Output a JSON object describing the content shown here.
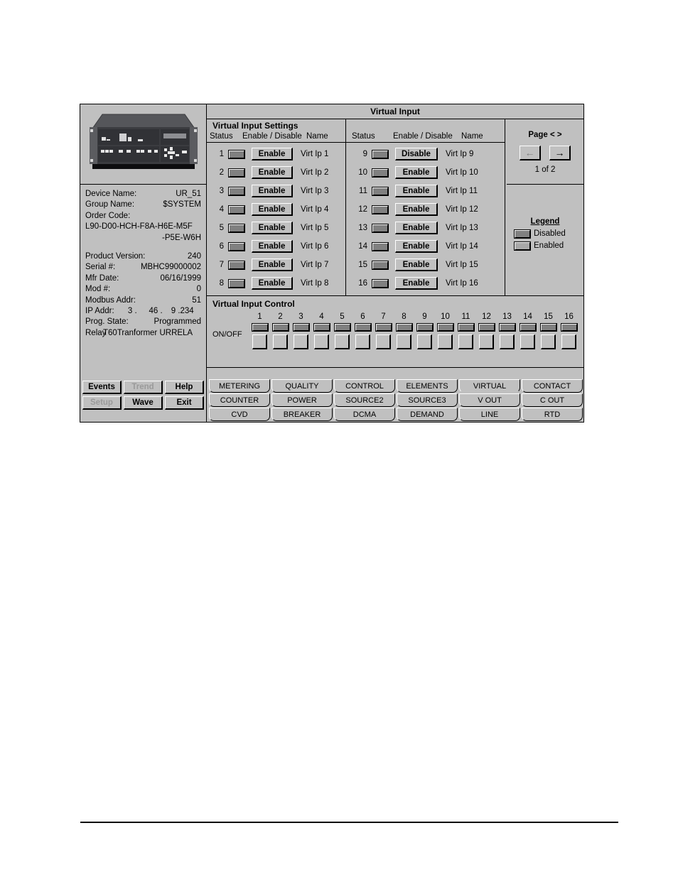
{
  "window": {
    "title": "Virtual Input"
  },
  "device": {
    "picture_alt": "relay-front-panel",
    "fields": [
      {
        "key": "Device Name:",
        "value": "UR_51"
      },
      {
        "key": "Group Name:",
        "value": "$SYSTEM"
      }
    ],
    "order_code_label": "Order Code:",
    "order_code_line1": "L90-D00-HCH-F8A-H6E-M5F",
    "order_code_line2": "-P5E-W6H",
    "fields2": [
      {
        "key": "Product Version:",
        "value": "240"
      },
      {
        "key": "Serial #:",
        "value": "MBHC99000002"
      },
      {
        "key": "Mfr Date:",
        "value": "06/16/1999"
      },
      {
        "key": "Mod #:",
        "value": "0"
      },
      {
        "key": "Modbus Addr:",
        "value": "51"
      }
    ],
    "ip_label": "IP Addr:",
    "ip_octets": [
      "3 .",
      "46 .",
      "9 .234"
    ],
    "prog_state_key": "Prog. State:",
    "prog_state_value": "Programmed",
    "footer_a": "Relay",
    "footer_b": "T60Tranformer URRELA"
  },
  "settings": {
    "panel_title": "Virtual Input Settings",
    "headers": {
      "status": "Status",
      "enable_disable": "Enable / Disable",
      "name": "Name"
    },
    "column1": [
      {
        "index": "1",
        "state": "disabled",
        "button": "Enable",
        "name": "Virt Ip 1"
      },
      {
        "index": "2",
        "state": "disabled",
        "button": "Enable",
        "name": "Virt Ip 2"
      },
      {
        "index": "3",
        "state": "disabled",
        "button": "Enable",
        "name": "Virt Ip 3"
      },
      {
        "index": "4",
        "state": "disabled",
        "button": "Enable",
        "name": "Virt Ip 4"
      },
      {
        "index": "5",
        "state": "disabled",
        "button": "Enable",
        "name": "Virt Ip 5"
      },
      {
        "index": "6",
        "state": "disabled",
        "button": "Enable",
        "name": "Virt Ip 6"
      },
      {
        "index": "7",
        "state": "disabled",
        "button": "Enable",
        "name": "Virt Ip 7"
      },
      {
        "index": "8",
        "state": "disabled",
        "button": "Enable",
        "name": "Virt Ip 8"
      }
    ],
    "column2": [
      {
        "index": "9",
        "state": "disabled",
        "button": "Disable",
        "name": "Virt Ip 9"
      },
      {
        "index": "10",
        "state": "disabled",
        "button": "Enable",
        "name": "Virt Ip 10"
      },
      {
        "index": "11",
        "state": "disabled",
        "button": "Enable",
        "name": "Virt Ip 11"
      },
      {
        "index": "12",
        "state": "disabled",
        "button": "Enable",
        "name": "Virt Ip 12"
      },
      {
        "index": "13",
        "state": "disabled",
        "button": "Enable",
        "name": "Virt Ip 13"
      },
      {
        "index": "14",
        "state": "disabled",
        "button": "Enable",
        "name": "Virt Ip 14"
      },
      {
        "index": "15",
        "state": "disabled",
        "button": "Enable",
        "name": "Virt Ip 15"
      },
      {
        "index": "16",
        "state": "disabled",
        "button": "Enable",
        "name": "Virt Ip 16"
      }
    ]
  },
  "page_nav": {
    "title": "Page < >",
    "prev_icon": "←",
    "next_icon": "→",
    "counter": "1 of 2"
  },
  "legend": {
    "title": "Legend",
    "items": [
      {
        "label": "Disabled",
        "state": "disabled"
      },
      {
        "label": "Enabled",
        "state": "enabled"
      }
    ]
  },
  "control": {
    "title": "Virtual Input Control",
    "onoff_label": "ON/OFF",
    "channels": [
      {
        "num": "1",
        "state": "off"
      },
      {
        "num": "2",
        "state": "off"
      },
      {
        "num": "3",
        "state": "off"
      },
      {
        "num": "4",
        "state": "off"
      },
      {
        "num": "5",
        "state": "off"
      },
      {
        "num": "6",
        "state": "off"
      },
      {
        "num": "7",
        "state": "off"
      },
      {
        "num": "8",
        "state": "off"
      },
      {
        "num": "9",
        "state": "off"
      },
      {
        "num": "10",
        "state": "off"
      },
      {
        "num": "11",
        "state": "off"
      },
      {
        "num": "12",
        "state": "off"
      },
      {
        "num": "13",
        "state": "off"
      },
      {
        "num": "14",
        "state": "off"
      },
      {
        "num": "15",
        "state": "off"
      },
      {
        "num": "16",
        "state": "off"
      }
    ]
  },
  "function_keys": {
    "row1": [
      {
        "label": "Events",
        "disabled": false
      },
      {
        "label": "Trend",
        "disabled": true
      },
      {
        "label": "Help",
        "disabled": false
      }
    ],
    "row2": [
      {
        "label": "Setup",
        "disabled": true
      },
      {
        "label": "Wave",
        "disabled": false
      },
      {
        "label": "Exit",
        "disabled": false
      }
    ]
  },
  "tabs": {
    "columns": [
      {
        "items": [
          "METERING",
          "COUNTER",
          "CVD"
        ]
      },
      {
        "items": [
          "QUALITY",
          "POWER",
          "BREAKER"
        ]
      },
      {
        "items": [
          "CONTROL",
          "SOURCE2",
          "DCMA"
        ]
      },
      {
        "items": [
          "ELEMENTS",
          "SOURCE3",
          "DEMAND"
        ]
      },
      {
        "items": [
          "VIRTUAL",
          "V OUT",
          "LINE"
        ]
      },
      {
        "items": [
          "CONTACT",
          "C OUT",
          "RTD"
        ]
      }
    ],
    "selected": "VIRTUAL"
  },
  "colors": {
    "face": "#c0c0c0",
    "led_disabled": "#808080",
    "led_enabled": "#a8a8a8",
    "text": "#000000",
    "text_disabled": "#9a9a9a"
  }
}
